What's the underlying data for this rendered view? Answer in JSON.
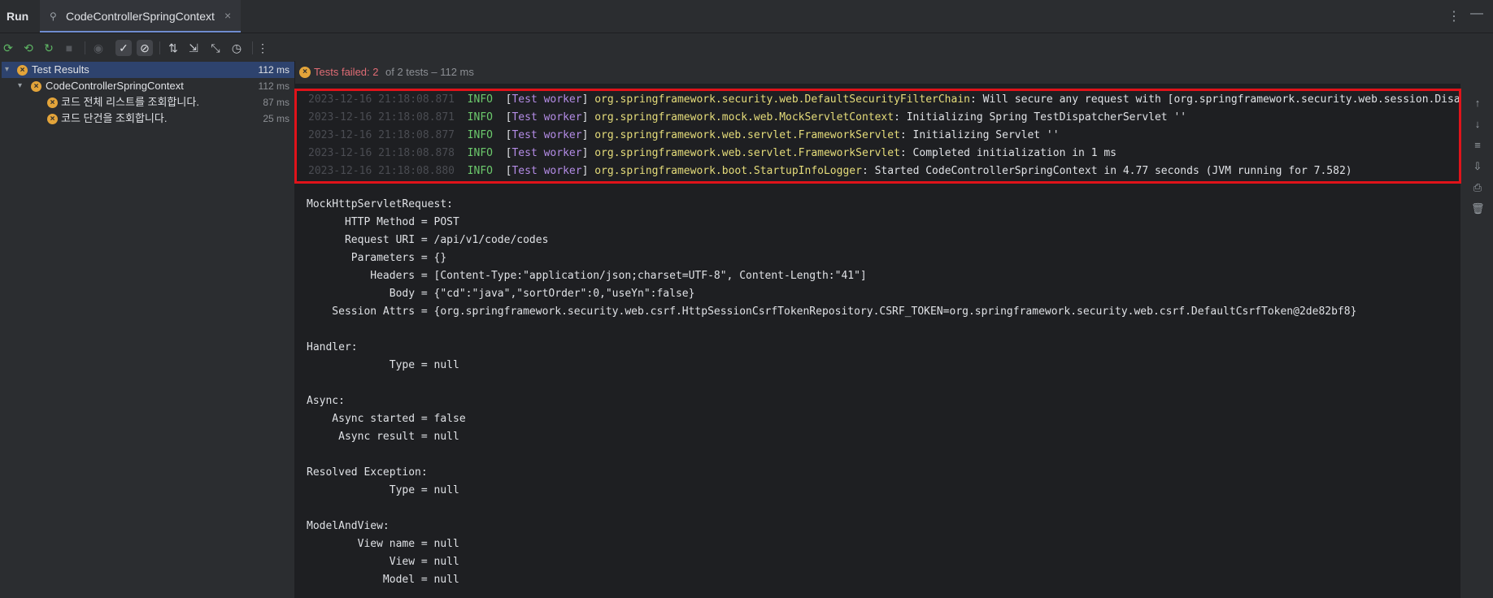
{
  "window": {
    "run_label": "Run",
    "tab_label": "CodeControllerSpringContext",
    "tab_close": "×",
    "more_menu": "⋮",
    "minimize": "—"
  },
  "toolbar": {
    "icons": [
      "rerun-icon",
      "rerun-failed-icon",
      "toggle-auto-test-icon",
      "stop-icon",
      "show-ignored-icon",
      "show-passed-icon",
      "show-ignored-toggle-icon",
      "sort-icon",
      "import-icon",
      "collapse-icon",
      "history-icon",
      "more-icon"
    ]
  },
  "tree": {
    "root": {
      "label": "Test Results",
      "time": "112 ms"
    },
    "suite": {
      "label": "CodeControllerSpringContext",
      "time": "112 ms"
    },
    "tests": [
      {
        "label": "코드 전체 리스트를 조회합니다.",
        "time": "87 ms"
      },
      {
        "label": "코드 단건을 조회합니다.",
        "time": "25 ms"
      }
    ]
  },
  "status": {
    "failed_text": "Tests failed: 2",
    "rest_text": "of 2 tests – 112 ms"
  },
  "log": [
    {
      "ts": "2023-12-16 21:18:08.871",
      "level": "INFO",
      "thread": "Test worker",
      "logger": "org.springframework.security.web.DefaultSecurityFilterChain",
      "msg": ": Will secure any request with [org.springframework.security.web.session.Disabl"
    },
    {
      "ts": "2023-12-16 21:18:08.871",
      "level": "INFO",
      "thread": "Test worker",
      "logger": "org.springframework.mock.web.MockServletContext",
      "msg": ": Initializing Spring TestDispatcherServlet ''"
    },
    {
      "ts": "2023-12-16 21:18:08.877",
      "level": "INFO",
      "thread": "Test worker",
      "logger": "org.springframework.web.servlet.FrameworkServlet",
      "msg": ": Initializing Servlet ''"
    },
    {
      "ts": "2023-12-16 21:18:08.878",
      "level": "INFO",
      "thread": "Test worker",
      "logger": "org.springframework.web.servlet.FrameworkServlet",
      "msg": ": Completed initialization in 1 ms"
    },
    {
      "ts": "2023-12-16 21:18:08.880",
      "level": "INFO",
      "thread": "Test worker",
      "logger": "org.springframework.boot.StartupInfoLogger",
      "msg": ": Started CodeControllerSpringContext in 4.77 seconds (JVM running for 7.582)"
    }
  ],
  "output": [
    "MockHttpServletRequest:",
    "      HTTP Method = POST",
    "      Request URI = /api/v1/code/codes",
    "       Parameters = {}",
    "          Headers = [Content-Type:\"application/json;charset=UTF-8\", Content-Length:\"41\"]",
    "             Body = {\"cd\":\"java\",\"sortOrder\":0,\"useYn\":false}",
    "    Session Attrs = {org.springframework.security.web.csrf.HttpSessionCsrfTokenRepository.CSRF_TOKEN=org.springframework.security.web.csrf.DefaultCsrfToken@2de82bf8}",
    "",
    "Handler:",
    "             Type = null",
    "",
    "Async:",
    "    Async started = false",
    "     Async result = null",
    "",
    "Resolved Exception:",
    "             Type = null",
    "",
    "ModelAndView:",
    "        View name = null",
    "             View = null",
    "            Model = null"
  ]
}
